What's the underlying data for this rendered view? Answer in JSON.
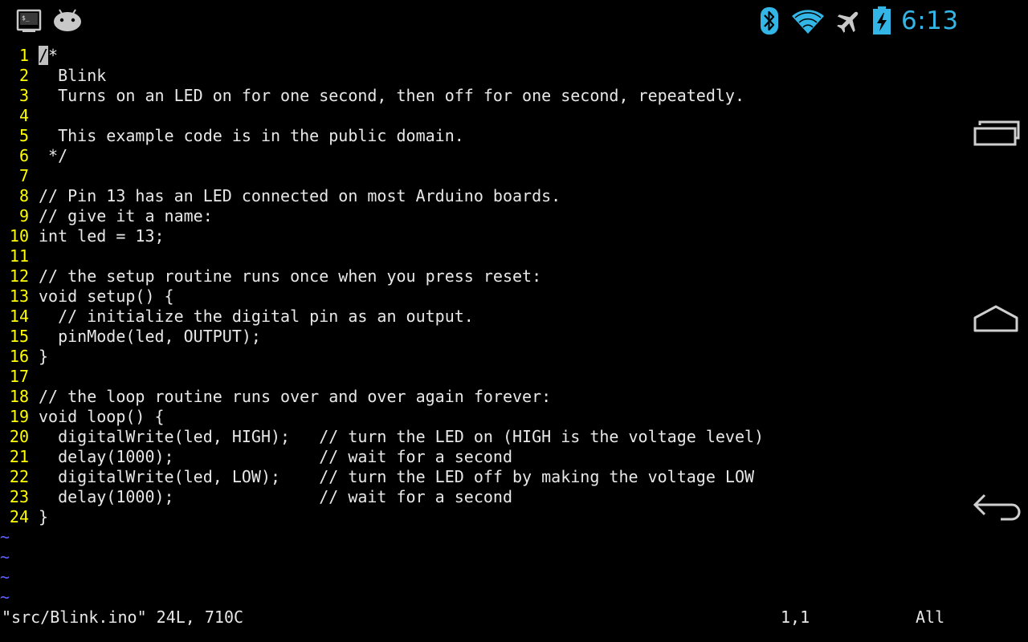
{
  "status_bar": {
    "time": "6:13",
    "icons": [
      "terminal-icon",
      "android-icon",
      "bluetooth-icon",
      "wifi-icon",
      "airplane-icon",
      "battery-charging-icon"
    ],
    "accent_color": "#33b5e5"
  },
  "editor": {
    "lines": [
      {
        "num": "1",
        "cursor": "/",
        "text": "*"
      },
      {
        "num": "2",
        "text": "  Blink"
      },
      {
        "num": "3",
        "text": "  Turns on an LED on for one second, then off for one second, repeatedly."
      },
      {
        "num": "4",
        "text": ""
      },
      {
        "num": "5",
        "text": "  This example code is in the public domain."
      },
      {
        "num": "6",
        "text": " */"
      },
      {
        "num": "7",
        "text": ""
      },
      {
        "num": "8",
        "text": "// Pin 13 has an LED connected on most Arduino boards."
      },
      {
        "num": "9",
        "text": "// give it a name:"
      },
      {
        "num": "10",
        "text": "int led = 13;"
      },
      {
        "num": "11",
        "text": ""
      },
      {
        "num": "12",
        "text": "// the setup routine runs once when you press reset:"
      },
      {
        "num": "13",
        "text": "void setup() {"
      },
      {
        "num": "14",
        "text": "  // initialize the digital pin as an output."
      },
      {
        "num": "15",
        "text": "  pinMode(led, OUTPUT);"
      },
      {
        "num": "16",
        "text": "}"
      },
      {
        "num": "17",
        "text": ""
      },
      {
        "num": "18",
        "text": "// the loop routine runs over and over again forever:"
      },
      {
        "num": "19",
        "text": "void loop() {"
      },
      {
        "num": "20",
        "text": "  digitalWrite(led, HIGH);   // turn the LED on (HIGH is the voltage level)"
      },
      {
        "num": "21",
        "text": "  delay(1000);               // wait for a second"
      },
      {
        "num": "22",
        "text": "  digitalWrite(led, LOW);    // turn the LED off by making the voltage LOW"
      },
      {
        "num": "23",
        "text": "  delay(1000);               // wait for a second"
      },
      {
        "num": "24",
        "text": "}"
      }
    ],
    "tildes": [
      "~",
      "~",
      "~",
      "~"
    ],
    "line_number_color": "#ffff00",
    "tilde_color": "#5f5fff"
  },
  "command_line": {
    "file_info": "\"src/Blink.ino\" 24L, 710C",
    "position": "1,1",
    "scroll": "All"
  },
  "nav_bar": {
    "buttons": [
      "recent-apps-button",
      "home-button",
      "back-button"
    ]
  }
}
